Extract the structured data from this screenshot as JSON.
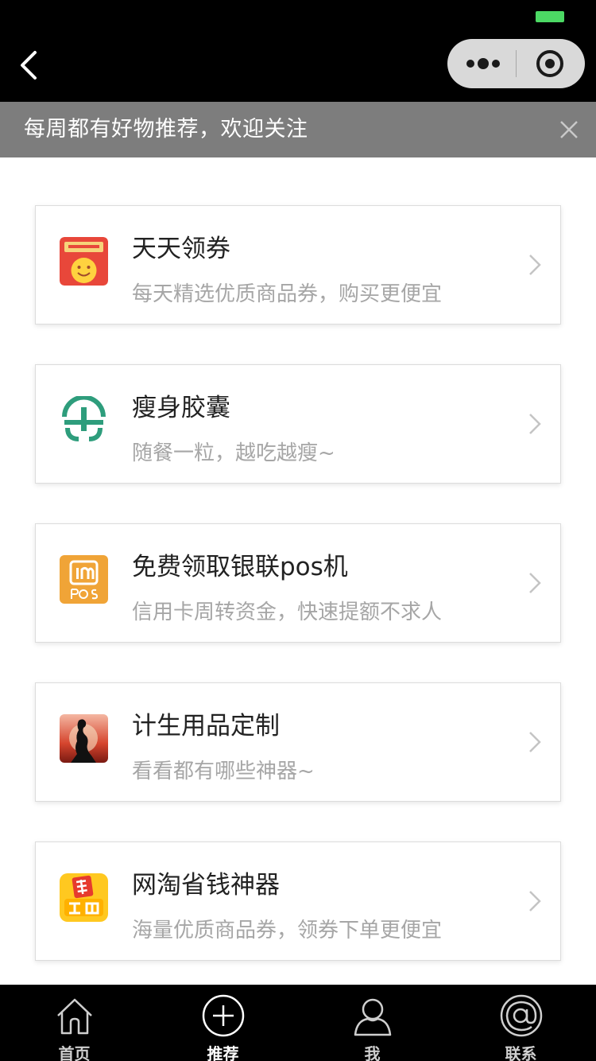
{
  "notice": {
    "text": "每周都有好物推荐，欢迎关注"
  },
  "items": [
    {
      "title": "天天领券",
      "desc": "每天精选优质商品券，购买更便宜",
      "icon": "coupon-face-icon"
    },
    {
      "title": "瘦身胶囊",
      "desc": "随餐一粒，越吃越瘦~",
      "icon": "slim-logo-icon"
    },
    {
      "title": "免费领取银联pos机",
      "desc": "信用卡周转资金，快速提额不求人",
      "icon": "pos-icon"
    },
    {
      "title": "计生用品定制",
      "desc": "看看都有哪些神器~",
      "icon": "silhouette-icon"
    },
    {
      "title": "网淘省钱神器",
      "desc": "海量优质商品券，领券下单更便宜",
      "icon": "discount-badge-icon"
    }
  ],
  "tabs": [
    {
      "label": "首页",
      "icon": "home-icon",
      "active": false
    },
    {
      "label": "推荐",
      "icon": "plus-circle-icon",
      "active": true
    },
    {
      "label": "我",
      "icon": "user-icon",
      "active": false
    },
    {
      "label": "联系",
      "icon": "at-sign-icon",
      "active": false
    }
  ],
  "colors": {
    "nav_background": "#000000",
    "notice_background": "#7d7d7d",
    "battery": "#4cd964",
    "title_text": "#222222",
    "desc_text": "#a6a6a6"
  },
  "tab_labels_unused": ""
}
